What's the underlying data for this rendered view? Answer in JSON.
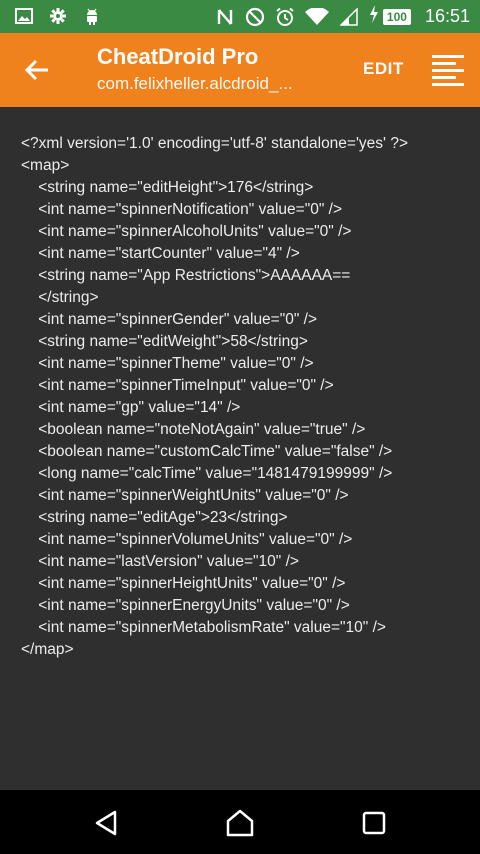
{
  "status_bar": {
    "time": "16:51",
    "battery_level": "100",
    "left_icons": [
      "image-icon",
      "settings-gear-icon",
      "android-icon"
    ],
    "right_icons": [
      "nfc-icon",
      "do-not-disturb-icon",
      "alarm-icon",
      "wifi-icon",
      "signal-icon",
      "charging-icon"
    ],
    "color": "#3a8a43"
  },
  "app_bar": {
    "title": "CheatDroid Pro",
    "subtitle": "com.felixheller.alcdroid_...",
    "edit_label": "EDIT",
    "color": "#f0821e"
  },
  "xml_lines": [
    "<?xml version='1.0' encoding='utf-8' standalone='yes' ?>",
    "<map>",
    "    <string name=\"editHeight\">176</string>",
    "    <int name=\"spinnerNotification\" value=\"0\" />",
    "    <int name=\"spinnerAlcoholUnits\" value=\"0\" />",
    "    <int name=\"startCounter\" value=\"4\" />",
    "    <string name=\"App Restrictions\">AAAAAA==",
    "    </string>",
    "    <int name=\"spinnerGender\" value=\"0\" />",
    "    <string name=\"editWeight\">58</string>",
    "    <int name=\"spinnerTheme\" value=\"0\" />",
    "    <int name=\"spinnerTimeInput\" value=\"0\" />",
    "    <int name=\"gp\" value=\"14\" />",
    "    <boolean name=\"noteNotAgain\" value=\"true\" />",
    "    <boolean name=\"customCalcTime\" value=\"false\" />",
    "    <long name=\"calcTime\" value=\"1481479199999\" />",
    "    <int name=\"spinnerWeightUnits\" value=\"0\" />",
    "    <string name=\"editAge\">23</string>",
    "    <int name=\"spinnerVolumeUnits\" value=\"0\" />",
    "    <int name=\"lastVersion\" value=\"10\" />",
    "    <int name=\"spinnerHeightUnits\" value=\"0\" />",
    "    <int name=\"spinnerEnergyUnits\" value=\"0\" />",
    "    <int name=\"spinnerMetabolismRate\" value=\"10\" />",
    "</map>"
  ],
  "nav_bar": {
    "buttons": [
      "back-icon",
      "home-icon",
      "recents-icon"
    ]
  }
}
